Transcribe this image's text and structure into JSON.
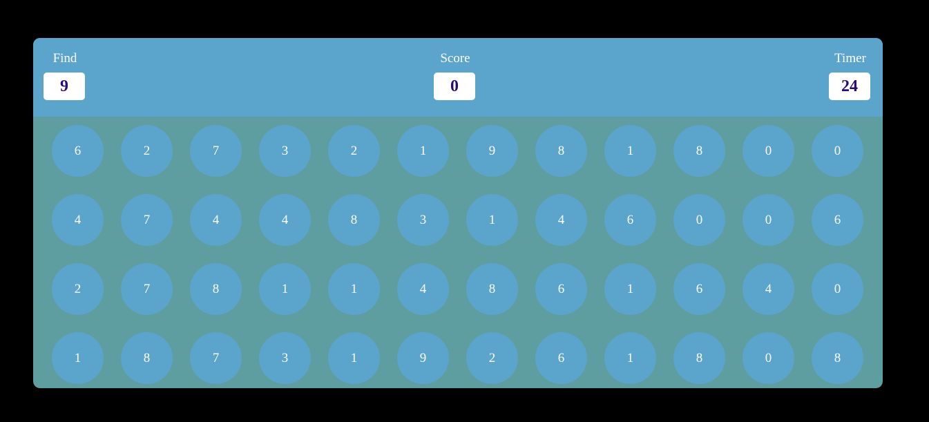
{
  "header": {
    "find": {
      "label": "Find",
      "value": "9"
    },
    "score": {
      "label": "Score",
      "value": "0"
    },
    "timer": {
      "label": "Timer",
      "value": "24"
    }
  },
  "board": {
    "rows": [
      [
        "6",
        "2",
        "7",
        "3",
        "2",
        "1",
        "9",
        "8",
        "1",
        "8",
        "0",
        "0"
      ],
      [
        "4",
        "7",
        "4",
        "4",
        "8",
        "3",
        "1",
        "4",
        "6",
        "0",
        "0",
        "6"
      ],
      [
        "2",
        "7",
        "8",
        "1",
        "1",
        "4",
        "8",
        "6",
        "1",
        "6",
        "4",
        "0"
      ],
      [
        "1",
        "8",
        "7",
        "3",
        "1",
        "9",
        "2",
        "6",
        "1",
        "8",
        "0",
        "8"
      ]
    ]
  },
  "colors": {
    "page_background": "#000000",
    "header_background": "#5ba4cc",
    "board_background": "#5f9ea0",
    "circle": "#5ba4cc",
    "value_text": "#2a0a7a"
  }
}
